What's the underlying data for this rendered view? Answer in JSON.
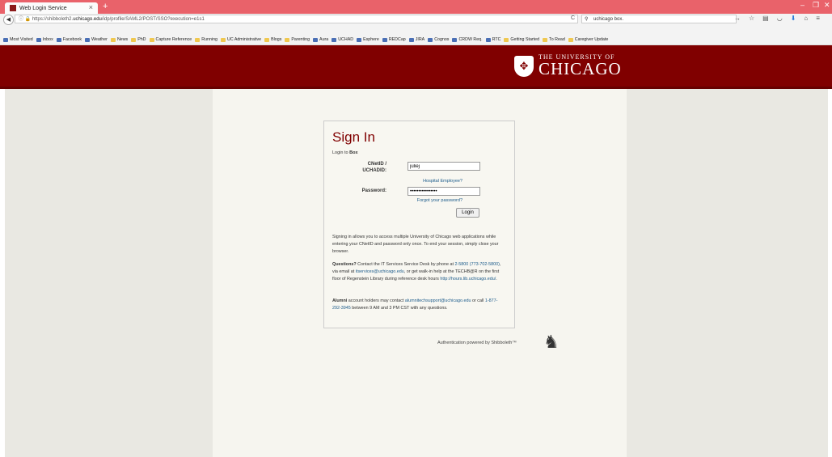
{
  "browser": {
    "tab_title": "Web Login Service",
    "tab_close": "×",
    "new_tab": "+",
    "url_prefix": "https://shibboleth2.",
    "url_domain": "uchicago.edu",
    "url_rest": "/idp/profile/SAML2/POST/SSO?execution=e1s1",
    "search_value": "uchicago box.",
    "bookmarks": [
      "Most Visited",
      "Inbox",
      "Facebook",
      "Weather",
      "News",
      "PhD",
      "Capture Reference",
      "Running",
      "UC Administrative",
      "Blogs",
      "Parenting",
      "Aura",
      "UCHAD",
      "Esphere",
      "REDCap",
      "JIRA",
      "Cognos",
      "CRDW Req.",
      "RTC",
      "Getting Started",
      "To Read",
      "Caregiver Update"
    ]
  },
  "header": {
    "logo_small": "THE UNIVERSITY OF",
    "logo_big": "CHICAGO"
  },
  "signin": {
    "title": "Sign In",
    "login_to_prefix": "Login to ",
    "login_to_service": "Box",
    "cnetid_label_1": "CNetID /",
    "cnetid_label_2": "UCHADID:",
    "cnetid_value": "juliej",
    "hospital_link": "Hospital Employee?",
    "password_label": "Password:",
    "password_value": "••••••••••••••••",
    "forgot_link": "Forgot your password?",
    "login_button": "Login",
    "info_text": "Signing in allows you to access multiple University of Chicago web applications while entering your CNetID and password only once. To end your session, simply close your browser.",
    "questions_bold": "Questions?",
    "questions_text_1": " Contact the IT Services Service Desk by phone at ",
    "questions_phone": "2-5800 (773-702-5800)",
    "questions_text_2": ", via email at ",
    "questions_email": "itservices@uchicago.edu",
    "questions_text_3": ", or get walk-in help at the TECHB@R on the first floor of Regenstein Library during reference desk hours ",
    "questions_hours_link": "http://hours.lib.uchicago.edu/",
    "questions_text_4": ".",
    "alumni_bold": "Alumni",
    "alumni_text_1": " account holders may contact ",
    "alumni_email": "alumnitechsupport@uchicago.edu",
    "alumni_text_2": " or call ",
    "alumni_phone": "1-877-292-3945",
    "alumni_text_3": " between 9 AM and 3 PM CST with any questions."
  },
  "footer": {
    "shibboleth_text": "Authentication powered by Shibboleth™"
  },
  "colors": {
    "maroon": "#800000",
    "link": "#1a5a8a",
    "tabbar": "#e9626a"
  }
}
